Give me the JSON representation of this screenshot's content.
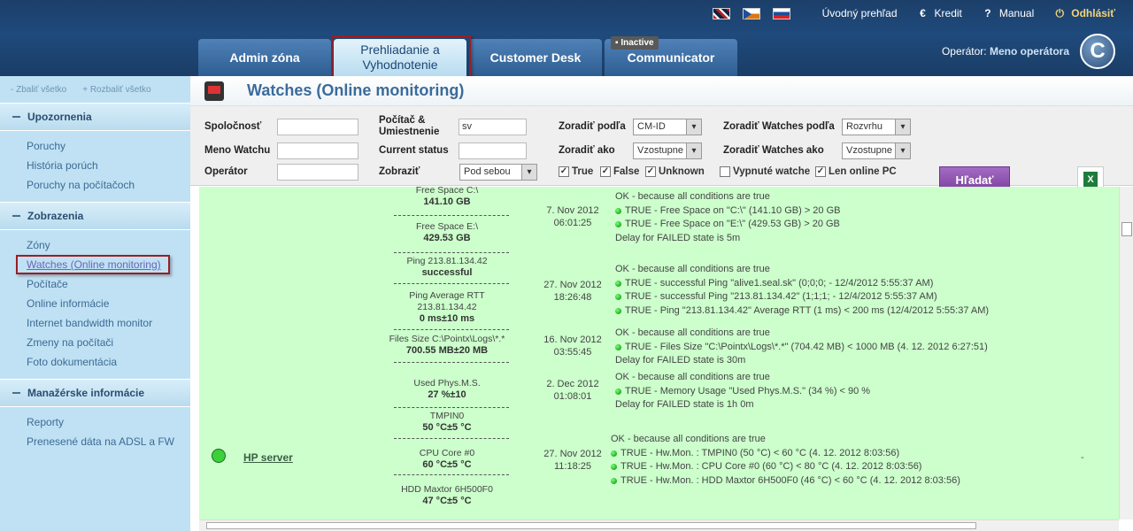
{
  "topbar": {
    "home": "Úvodný prehľad",
    "credit": "Kredit",
    "manual": "Manual",
    "logout": "Odhlásiť"
  },
  "tabs": [
    {
      "label": "Admin zóna"
    },
    {
      "label": "Prehliadanie a Vyhodnotenie"
    },
    {
      "label": "Customer Desk"
    },
    {
      "label": "Communicator"
    }
  ],
  "communicator_badge": "Inactive",
  "operator": {
    "prefix": "Operátor:",
    "name": "Meno operátora"
  },
  "sidebar": {
    "collapse_all": "- Zbaliť všetko",
    "expand_all": "+ Rozbaliť všetko",
    "sections": [
      {
        "title": "Upozornenia",
        "items": [
          "Poruchy",
          "História porúch",
          "Poruchy na počítačoch"
        ]
      },
      {
        "title": "Zobrazenia",
        "items": [
          "Zóny",
          "Watches (Online monitoring)",
          "Počítače",
          "Online informácie",
          "Internet bandwidth monitor",
          "Zmeny na počítači",
          "Foto dokumentácia"
        ]
      },
      {
        "title": "Manažérske informácie",
        "items": [
          "Reporty",
          "Prenesené dáta na ADSL a FW"
        ]
      }
    ]
  },
  "page_title": "Watches (Online monitoring)",
  "filters": {
    "company_label": "Spoločnosť",
    "company_value": "",
    "watch_name_label": "Meno Watchu",
    "watch_name_value": "",
    "operator_label": "Operátor",
    "operator_value": "",
    "computer_label": "Počítač & Umiestnenie",
    "computer_value": "sv",
    "current_status_label": "Current status",
    "current_status_value": "",
    "display_label": "Zobraziť",
    "display_value": "Pod sebou",
    "sort_by_label": "Zoradiť podľa",
    "sort_by_value": "CM-ID",
    "sort_as_label": "Zoradiť ako",
    "sort_as_value": "Vzostupne",
    "sort_watches_by_label": "Zoradiť Watches podľa",
    "sort_watches_by_value": "Rozvrhu",
    "sort_watches_as_label": "Zoradiť Watches ako",
    "sort_watches_as_value": "Vzostupne",
    "cb_true": "True",
    "cb_false": "False",
    "cb_unknown": "Unknown",
    "cb_disabled": "Vypnuté watche",
    "cb_online": "Len online PC",
    "search_button": "Hľadať"
  },
  "server": {
    "name": "HP server",
    "extra": "-"
  },
  "rows": [
    {
      "metrics": [
        {
          "name": "Free Space C:\\",
          "value": "141.10 GB"
        },
        {
          "name": "Free Space E:\\",
          "value": "429.53 GB"
        }
      ],
      "date": "7. Nov 2012",
      "time": "06:01:25",
      "status_head": "OK - because all conditions are true",
      "conditions": [
        "TRUE - Free Space on \"C:\\\" (141.10 GB) > 20 GB",
        "TRUE - Free Space on \"E:\\\" (429.53 GB) > 20 GB"
      ],
      "delay": "Delay for FAILED state is 5m"
    },
    {
      "metrics": [
        {
          "name": "Ping 213.81.134.42",
          "value": "successful"
        },
        {
          "name": "Ping Average RTT 213.81.134.42",
          "value": "0 ms±10 ms"
        }
      ],
      "date": "27. Nov 2012",
      "time": "18:26:48",
      "status_head": "OK - because all conditions are true",
      "conditions": [
        "TRUE - successful Ping \"alive1.seal.sk\" (0;0;0; - 12/4/2012 5:55:37 AM)",
        "TRUE - successful Ping \"213.81.134.42\" (1;1;1; - 12/4/2012 5:55:37 AM)",
        "TRUE - Ping \"213.81.134.42\" Average RTT (1 ms) < 200 ms (12/4/2012 5:55:37 AM)"
      ],
      "delay": ""
    },
    {
      "metrics": [
        {
          "name": "Files Size C:\\Pointx\\Logs\\*.*",
          "value": "700.55 MB±20 MB"
        }
      ],
      "date": "16. Nov 2012",
      "time": "03:55:45",
      "status_head": "OK - because all conditions are true",
      "conditions": [
        "TRUE - Files Size \"C:\\Pointx\\Logs\\*.*\" (704.42 MB) < 1000 MB (4. 12. 2012 6:27:51)"
      ],
      "delay": "Delay for FAILED state is 30m"
    },
    {
      "metrics": [
        {
          "name": "Used Phys.M.S.",
          "value": "27 %±10"
        }
      ],
      "date": "2. Dec 2012",
      "time": "01:08:01",
      "status_head": "OK - because all conditions are true",
      "conditions": [
        "TRUE - Memory Usage \"Used Phys.M.S.\" (34 %) < 90 %"
      ],
      "delay": "Delay for FAILED state is 1h 0m"
    },
    {
      "metrics": [
        {
          "name": "TMPIN0",
          "value": "50 °C±5 °C"
        },
        {
          "name": "CPU Core #0",
          "value": "60 °C±5 °C"
        },
        {
          "name": "HDD Maxtor 6H500F0",
          "value": "47 °C±5 °C"
        }
      ],
      "date": "27. Nov 2012",
      "time": "11:18:25",
      "status_head": "OK - because all conditions are true",
      "conditions": [
        "TRUE - Hw.Mon. : TMPIN0 (50 °C) < 60 °C (4. 12. 2012 8:03:56)",
        "TRUE - Hw.Mon. : CPU Core #0 (60 °C) < 80 °C (4. 12. 2012 8:03:56)",
        "TRUE - Hw.Mon. : HDD Maxtor 6H500F0 (46 °C) < 60 °C (4. 12. 2012 8:03:56)"
      ],
      "delay": ""
    }
  ]
}
